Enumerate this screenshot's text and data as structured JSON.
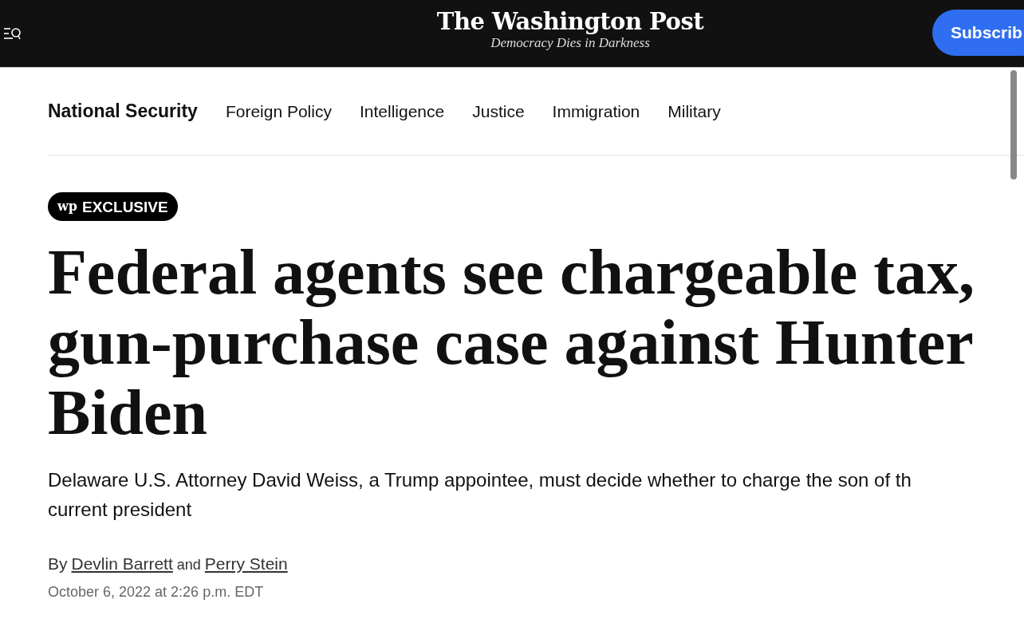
{
  "header": {
    "logo": "The Washington Post",
    "tagline": "Democracy Dies in Darkness",
    "subscribe_button": "Subscrib"
  },
  "section_nav": [
    {
      "label": "National Security",
      "selected": true
    },
    {
      "label": "Foreign Policy",
      "selected": false
    },
    {
      "label": "Intelligence",
      "selected": false
    },
    {
      "label": "Justice",
      "selected": false
    },
    {
      "label": "Immigration",
      "selected": false
    },
    {
      "label": "Military",
      "selected": false
    }
  ],
  "badge": {
    "logo": "wp",
    "label": "EXCLUSIVE"
  },
  "headline": "Federal agents see chargeable tax, gun-purchase case against Hunter Biden",
  "subheadline_lines": [
    "Delaware U.S. Attorney David Weiss, a Trump appointee, must decide whether to charge the son of th",
    "current president"
  ],
  "byline": {
    "prefix": "By",
    "authors": [
      "Devlin Barrett",
      "Perry Stein"
    ],
    "joiner": "and"
  },
  "timestamp": "October 6, 2022 at 2:26 p.m. EDT"
}
